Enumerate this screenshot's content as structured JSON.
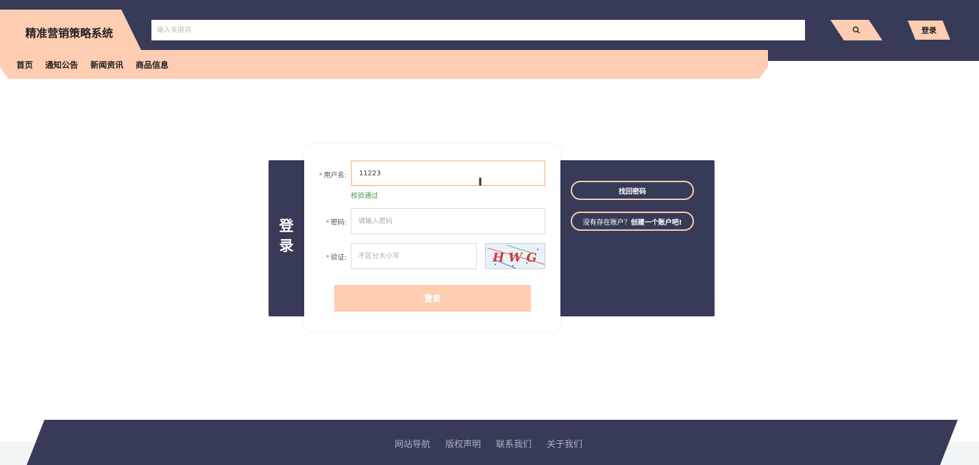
{
  "header": {
    "brand_title": "精准营销策略系统",
    "search_placeholder": "输入关键词",
    "search_icon": "search-icon",
    "login_label": "登录"
  },
  "nav": {
    "items": [
      {
        "label": "首页"
      },
      {
        "label": "通知公告"
      },
      {
        "label": "新闻资讯"
      },
      {
        "label": "商品信息"
      }
    ]
  },
  "login": {
    "side_title": "登录",
    "username_label": "用户名:",
    "username_value": "11223",
    "username_hint": "校验通过",
    "password_label": "密码:",
    "password_placeholder": "请输入密码",
    "captcha_label": "验证:",
    "captcha_placeholder": "不区分大小写",
    "captcha_text": "HWG",
    "submit_label": "登录",
    "forgot_label": "找回密码",
    "register_prefix": "没有存在账户？",
    "register_link": "创建一个账户吧!"
  },
  "footer": {
    "links": [
      {
        "label": "网站导航"
      },
      {
        "label": "版权声明"
      },
      {
        "label": "联系我们"
      },
      {
        "label": "关于我们"
      }
    ]
  },
  "colors": {
    "dark": "#373b57",
    "accent": "#fecdb2",
    "success": "#3a9a4e",
    "required": "#e0523b"
  }
}
